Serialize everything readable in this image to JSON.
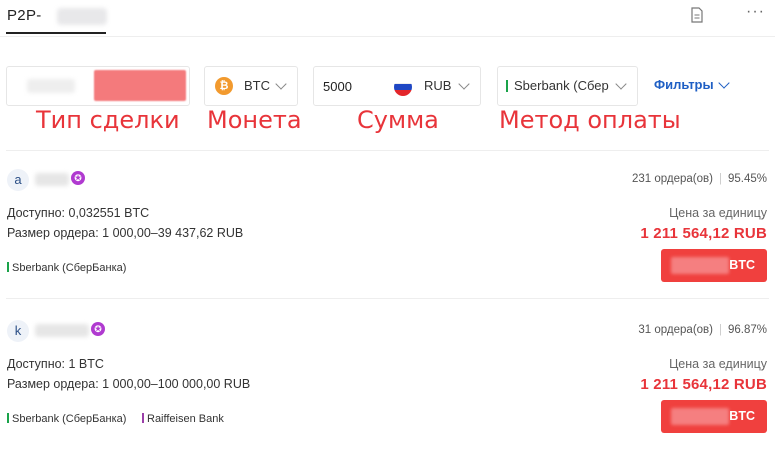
{
  "header": {
    "title": "P2P-",
    "title_blurred": true,
    "icons": [
      "document-icon",
      "more-icon"
    ],
    "more_glyph": "···"
  },
  "filters": {
    "trade_type": {
      "buy_label_blurred": true,
      "sell_label_blurred": true
    },
    "coin": {
      "icon": "btc-icon",
      "icon_glyph": "₿",
      "label": "BTC"
    },
    "amount": {
      "value": "5000",
      "currency": "RUB",
      "flag_icon": "russia-flag-icon"
    },
    "payment_method": {
      "label": "Sberbank (Сберб"
    },
    "filters_button": "Фильтры"
  },
  "annotations": {
    "trade_type": "Тип сделки",
    "coin": "Монета",
    "amount": "Сумма",
    "payment_method": "Метод оплаты"
  },
  "offers": [
    {
      "avatar_letter": "a",
      "name_blurred": true,
      "badge_glyph": "✪",
      "orders": "231 ордера(ов)",
      "completion": "95.45%",
      "available": "Доступно: 0,032551 BTC",
      "limits": "Размер ордера: 1 000,00–39 437,62 RUB",
      "unit_price_label": "Цена за единицу",
      "price": "1 211 564,12 RUB",
      "payment_methods": [
        {
          "label": "Sberbank (СберБанка)",
          "color": "#1aa34a"
        }
      ],
      "button_coin": "BTC"
    },
    {
      "avatar_letter": "k",
      "name_blurred": true,
      "badge_glyph": "✪",
      "orders": "31 ордера(ов)",
      "completion": "96.87%",
      "available": "Доступно: 1 BTC",
      "limits": "Размер ордера: 1 000,00–100 000,00 RUB",
      "unit_price_label": "Цена за единицу",
      "price": "1 211 564,12 RUB",
      "payment_methods": [
        {
          "label": "Sberbank (СберБанка)",
          "color": "#1aa34a"
        },
        {
          "label": "Raiffeisen Bank",
          "color": "#9a3fa8"
        }
      ],
      "button_coin": "BTC"
    }
  ],
  "colors": {
    "accent_red": "#e8343a",
    "button_red": "#f0403e",
    "link_blue": "#1f5fc4",
    "btc_orange": "#f29a2e"
  }
}
